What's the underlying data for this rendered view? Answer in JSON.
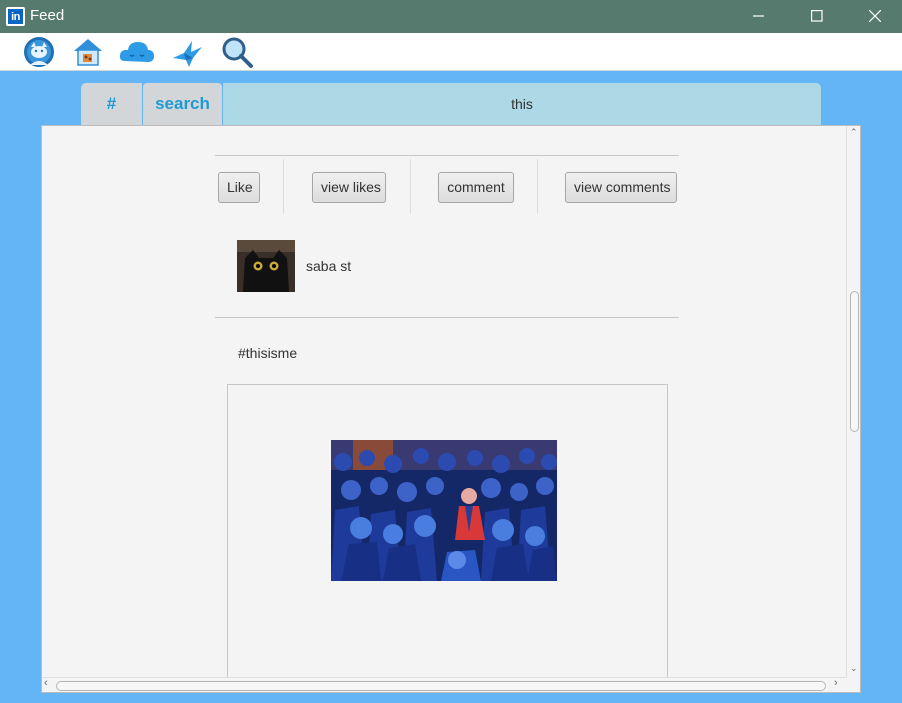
{
  "window": {
    "title": "Feed",
    "logo": "linkedin-logo",
    "logo_text": "in"
  },
  "toolbar": {
    "icons": [
      "profile-cat-icon",
      "home-icon",
      "cloud-icon",
      "bird-icon",
      "search-magnifier-icon"
    ]
  },
  "search": {
    "hash_tab": "#",
    "search_tab": "search",
    "query": "this"
  },
  "post": {
    "actions": {
      "like": "Like",
      "view_likes": "view likes",
      "comment": "comment",
      "view_comments": "view comments"
    },
    "author": "saba st",
    "hashtag": "#thisisme",
    "image": "crowd-illustration"
  },
  "colors": {
    "titlebar": "#577a6e",
    "background": "#64b5f6",
    "tab_text": "#1d9bd7",
    "search_field": "#add8e6"
  }
}
